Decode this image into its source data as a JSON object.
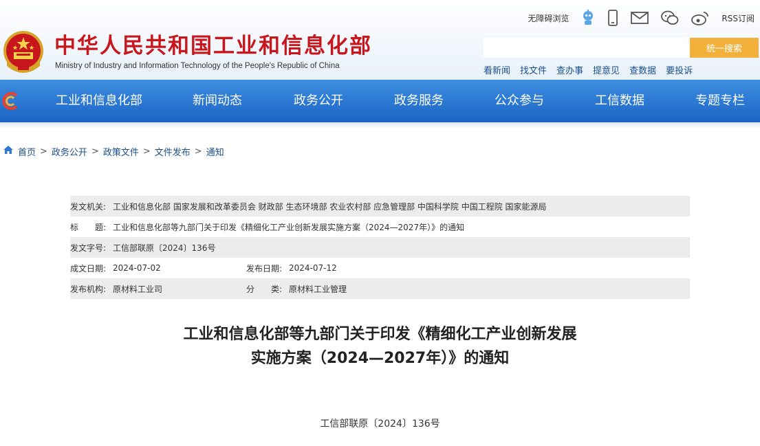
{
  "header": {
    "title": "中华人民共和国工业和信息化部",
    "subtitle": "Ministry of Industry and Information Technology of the People's Republic of China",
    "top_links": [
      {
        "label": "无障碍浏览",
        "icon": "accessibility"
      },
      {
        "label": "",
        "icon": "robot-icon"
      },
      {
        "label": "",
        "icon": "mobile-icon"
      },
      {
        "label": "",
        "icon": "mail-icon"
      },
      {
        "label": "",
        "icon": "wechat-icon"
      },
      {
        "label": "",
        "icon": "weibo-icon"
      },
      {
        "label": "RSS订阅",
        "icon": "rss"
      }
    ],
    "search": {
      "placeholder": "",
      "value": "",
      "button_label": "统一搜索"
    },
    "quick_links": [
      "看新闻",
      "找文件",
      "查办事",
      "提意见",
      "查数据",
      "要投诉"
    ]
  },
  "nav": {
    "items": [
      "工业和信息化部",
      "新闻动态",
      "政务公开",
      "政务服务",
      "公众参与",
      "工信数据",
      "专题专栏"
    ]
  },
  "breadcrumb": [
    "首页",
    "政务公开",
    "政策文件",
    "文件发布",
    "通知"
  ],
  "info": {
    "issuer_label": "发文机关:",
    "issuer_value": "工业和信息化部 国家发展和改革委员会 财政部 生态环境部 农业农村部 应急管理部 中国科学院 中国工程院 国家能源局",
    "title_label": "标　　题:",
    "title_value": "工业和信息化部等九部门关于印发《精细化工产业创新发展实施方案（2024—2027年）》的通知",
    "docno_label": "发文字号:",
    "docno_value": "工信部联原〔2024〕136号",
    "created_label": "成文日期:",
    "created_value": "2024-07-02",
    "published_label": "发布日期:",
    "published_value": "2024-07-12",
    "org_label": "发布机构:",
    "org_value": "原材料工业司",
    "category_label": "分　　类:",
    "category_value": "原材料工业管理"
  },
  "article": {
    "title_line1": "工业和信息化部等九部门关于印发《精细化工产业创新发展",
    "title_line2": "实施方案（2024—2027年）》的通知",
    "doc_number": "工信部联原〔2024〕136号"
  },
  "colors": {
    "title_red": "#c8161d",
    "nav_blue": "#1c64c5",
    "search_button": "#f3b13c",
    "link_blue": "#1a4f8c",
    "info_row_gray": "#ececec"
  }
}
